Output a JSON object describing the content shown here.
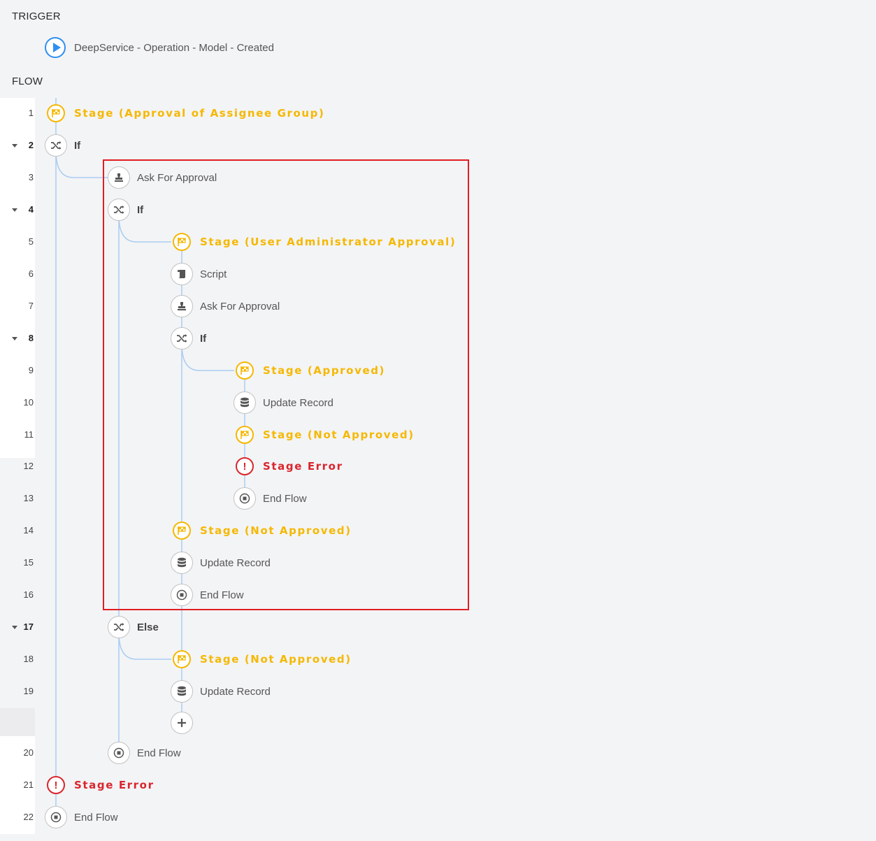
{
  "sections": {
    "trigger": "TRIGGER",
    "flow": "FLOW"
  },
  "trigger": {
    "label": "DeepService - Operation - Model - Created",
    "icon": "play-icon",
    "color": "#2f8ff0"
  },
  "colors": {
    "stage": "#f5b800",
    "error": "#d9262d",
    "connector": "#a9cdf2",
    "highlight": "#e11e22"
  },
  "lines": [
    {
      "num": "1",
      "label": "Stage (Approval of Assignee Group)",
      "type": "stage",
      "icon": "stage-flag-icon"
    },
    {
      "num": "2",
      "label": "If",
      "type": "if",
      "icon": "branch-icon",
      "collapsible": true
    },
    {
      "num": "3",
      "label": "Ask For Approval",
      "type": "action",
      "icon": "approval-stamp-icon"
    },
    {
      "num": "4",
      "label": "If",
      "type": "if",
      "icon": "branch-icon",
      "collapsible": true
    },
    {
      "num": "5",
      "label": "Stage (User Administrator Approval)",
      "type": "stage",
      "icon": "stage-flag-icon"
    },
    {
      "num": "6",
      "label": "Script",
      "type": "action",
      "icon": "script-icon"
    },
    {
      "num": "7",
      "label": "Ask For Approval",
      "type": "action",
      "icon": "approval-stamp-icon"
    },
    {
      "num": "8",
      "label": "If",
      "type": "if",
      "icon": "branch-icon",
      "collapsible": true
    },
    {
      "num": "9",
      "label": "Stage (Approved)",
      "type": "stage",
      "icon": "stage-flag-icon"
    },
    {
      "num": "10",
      "label": "Update Record",
      "type": "action",
      "icon": "database-icon"
    },
    {
      "num": "11",
      "label": "Stage (Not Approved)",
      "type": "stage",
      "icon": "stage-flag-icon"
    },
    {
      "num": "12",
      "label": "Stage Error",
      "type": "error",
      "icon": "error-icon"
    },
    {
      "num": "13",
      "label": "End Flow",
      "type": "action",
      "icon": "stop-icon"
    },
    {
      "num": "14",
      "label": "Stage (Not Approved)",
      "type": "stage",
      "icon": "stage-flag-icon"
    },
    {
      "num": "15",
      "label": "Update Record",
      "type": "action",
      "icon": "database-icon"
    },
    {
      "num": "16",
      "label": "End Flow",
      "type": "action",
      "icon": "stop-icon"
    },
    {
      "num": "17",
      "label": "Else",
      "type": "if",
      "icon": "branch-icon",
      "collapsible": true
    },
    {
      "num": "18",
      "label": "Stage (Not Approved)",
      "type": "stage",
      "icon": "stage-flag-icon"
    },
    {
      "num": "19",
      "label": "Update Record",
      "type": "action",
      "icon": "database-icon"
    },
    {
      "num": "",
      "label": "",
      "type": "add",
      "icon": "plus-icon"
    },
    {
      "num": "20",
      "label": "End Flow",
      "type": "action",
      "icon": "stop-icon"
    },
    {
      "num": "21",
      "label": "Stage Error",
      "type": "error",
      "icon": "error-icon"
    },
    {
      "num": "22",
      "label": "End Flow",
      "type": "action",
      "icon": "stop-icon"
    }
  ]
}
